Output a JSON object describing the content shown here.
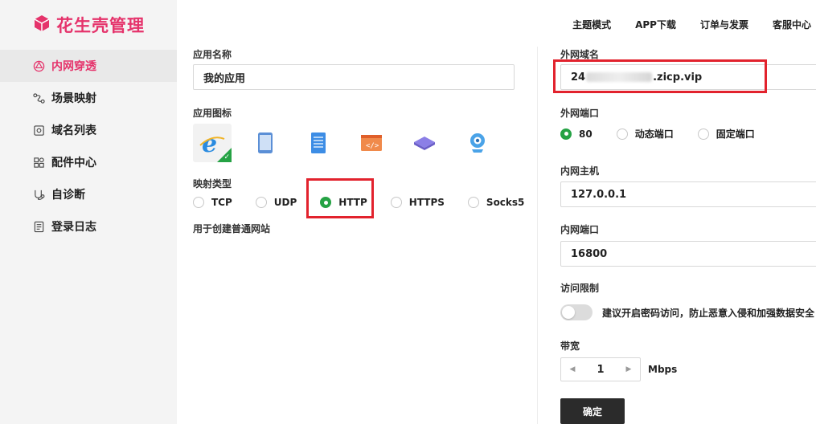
{
  "brand": {
    "name": "花生壳管理",
    "color": "#e5336b"
  },
  "sidebar": {
    "items": [
      {
        "label": "内网穿透",
        "icon": "network-icon",
        "active": true
      },
      {
        "label": "场景映射",
        "icon": "scene-map-icon",
        "active": false
      },
      {
        "label": "域名列表",
        "icon": "domain-list-icon",
        "active": false
      },
      {
        "label": "配件中心",
        "icon": "accessories-icon",
        "active": false
      },
      {
        "label": "自诊断",
        "icon": "diagnose-icon",
        "active": false
      },
      {
        "label": "登录日志",
        "icon": "log-icon",
        "active": false
      }
    ]
  },
  "header": {
    "links": [
      "主题模式",
      "APP下载",
      "订单与发票",
      "客服中心"
    ]
  },
  "form": {
    "app_name_label": "应用名称",
    "app_name_value": "我的应用",
    "app_icon_label": "应用图标",
    "app_icons": [
      "ie-icon",
      "tablet-icon",
      "server-icon",
      "code-window-icon",
      "router-icon",
      "webcam-icon"
    ],
    "mapping_type_label": "映射类型",
    "mapping_types": [
      "TCP",
      "UDP",
      "HTTP",
      "HTTPS",
      "Socks5"
    ],
    "mapping_type_selected": "HTTP",
    "mapping_hint": "用于创建普通网站",
    "external_domain_label": "外网域名",
    "external_domain_prefix": "24",
    "external_domain_suffix": ".zicp.vip",
    "external_port_label": "外网端口",
    "external_port_options": [
      "80",
      "动态端口",
      "固定端口"
    ],
    "external_port_selected": "80",
    "internal_host_label": "内网主机",
    "internal_host_value": "127.0.0.1",
    "internal_port_label": "内网端口",
    "internal_port_value": "16800",
    "access_limit_label": "访问限制",
    "access_limit_hint": "建议开启密码访问，防止恶意入侵和加强数据安全",
    "access_limit_enabled": false,
    "bandwidth_label": "带宽",
    "bandwidth_value": "1",
    "bandwidth_unit": "Mbps",
    "confirm_label": "确定"
  },
  "colors": {
    "accent": "#e5336b",
    "selected": "#25a244",
    "highlight": "#e2222d"
  }
}
